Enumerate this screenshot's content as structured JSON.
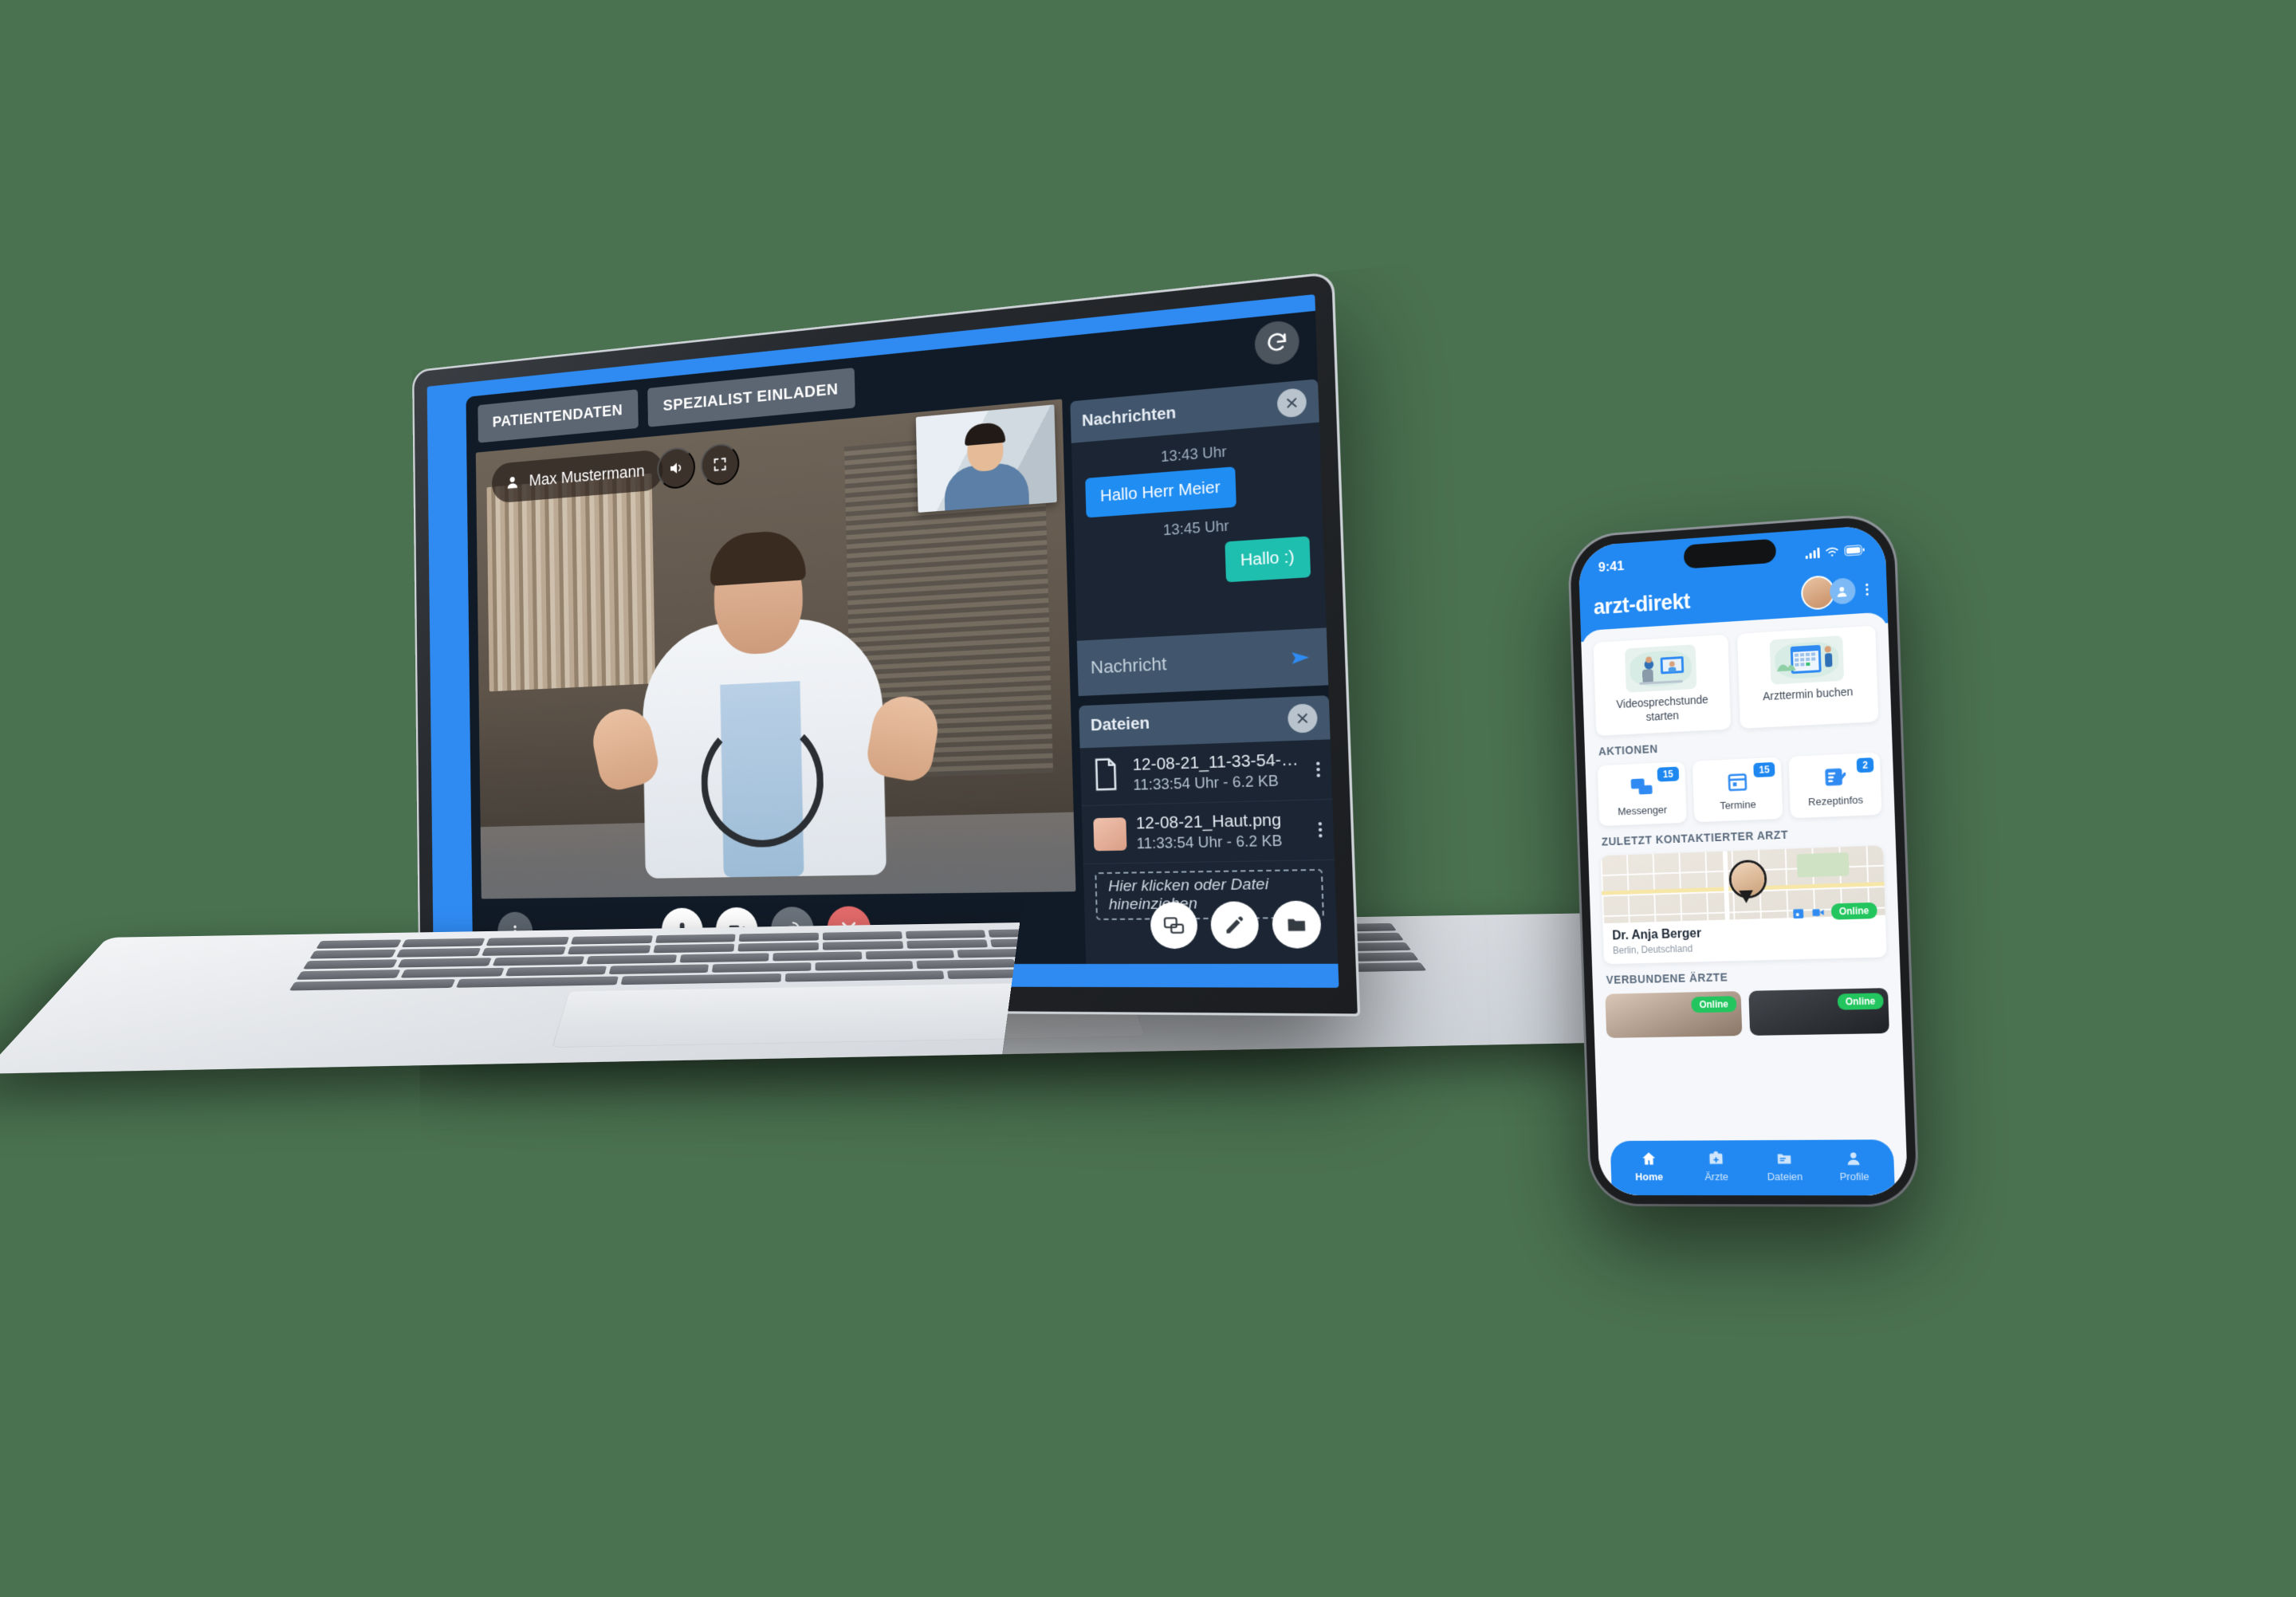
{
  "desktop": {
    "tabs": [
      {
        "label": "PATIENTENDATEN"
      },
      {
        "label": "SPEZIALIST EINLADEN"
      }
    ],
    "refresh_icon": "refresh-icon",
    "video": {
      "participant_name": "Max Mustermann",
      "person_icon": "person-icon",
      "speaker_icon": "speaker-icon",
      "expand_icon": "expand-icon",
      "self_view_label": "self-view"
    },
    "controls": {
      "more_icon": "more-options-icon",
      "mic_icon": "microphone-icon",
      "camera_icon": "video-camera-icon",
      "flip_icon": "camera-flip-icon",
      "end_icon": "end-call-icon"
    },
    "float_actions": {
      "chat_icon": "chat-icon",
      "draw_icon": "pencil-icon",
      "files_icon": "folder-icon"
    },
    "messages_panel": {
      "title": "Nachrichten",
      "close_icon": "close-icon",
      "entries": [
        {
          "time": "13:43 Uhr",
          "text": "Hallo Herr Meier",
          "direction": "in"
        },
        {
          "time": "13:45 Uhr",
          "text": "Hallo :)",
          "direction": "out"
        }
      ],
      "input_placeholder": "Nachricht",
      "send_icon": "send-icon"
    },
    "files_panel": {
      "title": "Dateien",
      "close_icon": "close-icon",
      "files": [
        {
          "name": "12-08-21_11-33-54-61...",
          "meta": "11:33:54 Uhr - 6.2 KB",
          "icon": "document-icon"
        },
        {
          "name": "12-08-21_Haut.png",
          "meta": "11:33:54 Uhr - 6.2 KB",
          "icon": "image-thumbnail"
        }
      ],
      "dropzone_text": "Hier klicken oder Datei hineinziehen",
      "menu_icon": "kebab-menu-icon"
    },
    "colors": {
      "frame_blue": "#2f8bf2",
      "app_background": "#111b27",
      "panel_header": "#41566c",
      "bubble_in": "#1f8df2",
      "bubble_out": "#1fbfb0",
      "end_call_red": "#e46b6b"
    }
  },
  "phone": {
    "status_bar": {
      "time": "9:41",
      "signal_icon": "cellular-signal-icon",
      "wifi_icon": "wifi-icon",
      "battery_icon": "battery-icon"
    },
    "appbar": {
      "title": "arzt-direkt",
      "avatar_icon": "user-avatar",
      "add_user_icon": "add-person-icon",
      "menu_icon": "kebab-menu-icon"
    },
    "top_cards": [
      {
        "label": "Videosprechstunde starten",
        "icon": "video-consultation-illustration"
      },
      {
        "label": "Arzttermin buchen",
        "icon": "calendar-booking-illustration"
      }
    ],
    "actions": {
      "section_title": "AKTIONEN",
      "items": [
        {
          "label": "Messenger",
          "badge": "15",
          "icon": "chat-bubbles-icon"
        },
        {
          "label": "Termine",
          "badge": "15",
          "icon": "calendar-icon"
        },
        {
          "label": "Rezeptinfos",
          "badge": "2",
          "icon": "checklist-icon"
        }
      ]
    },
    "last_doctor": {
      "section_title": "ZULETZT KONTAKTIERTER ARZT",
      "name": "Dr. Anja Berger",
      "location": "Berlin, Deutschland",
      "status": "Online",
      "calendar_icon": "calendar-icon",
      "video_icon": "video-call-icon",
      "map_icon": "map-thumbnail",
      "pin_icon": "map-pin-avatar"
    },
    "connected_doctors": {
      "section_title": "VERBUNDENE ÄRZTE",
      "items": [
        {
          "status": "Online"
        },
        {
          "status": "Online"
        }
      ]
    },
    "tabbar": [
      {
        "label": "Home",
        "icon": "home-icon",
        "active": true
      },
      {
        "label": "Ärzte",
        "icon": "medical-bag-icon",
        "active": false
      },
      {
        "label": "Dateien",
        "icon": "folder-icon",
        "active": false
      },
      {
        "label": "Profile",
        "icon": "person-icon",
        "active": false
      }
    ],
    "colors": {
      "brand_blue": "#2289f2",
      "online_green": "#22c55e",
      "badge_blue": "#1e88f0"
    }
  }
}
